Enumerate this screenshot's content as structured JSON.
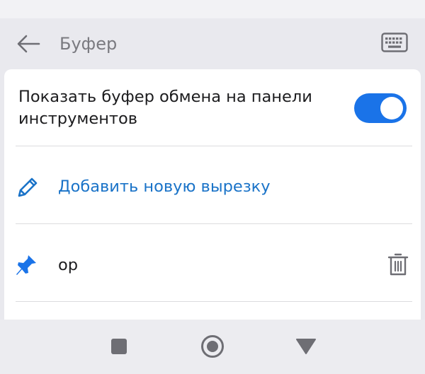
{
  "header": {
    "title": "Буфер",
    "back_icon": "arrow-left-icon",
    "keyboard_icon": "keyboard-icon"
  },
  "settings": {
    "show_clipboard_label": "Показать буфер обмена на панели инструментов",
    "show_clipboard_enabled": true,
    "toggle_color": "#1a73e8"
  },
  "add_clip": {
    "label": "Добавить новую вырезку",
    "icon": "pencil-icon",
    "color": "#1a73c8"
  },
  "clips": [
    {
      "text": "ор",
      "pinned": true,
      "pin_icon": "pin-icon",
      "delete_icon": "trash-icon"
    }
  ],
  "nav": {
    "items": [
      "square-icon",
      "home-circle-icon",
      "back-triangle-icon"
    ]
  }
}
